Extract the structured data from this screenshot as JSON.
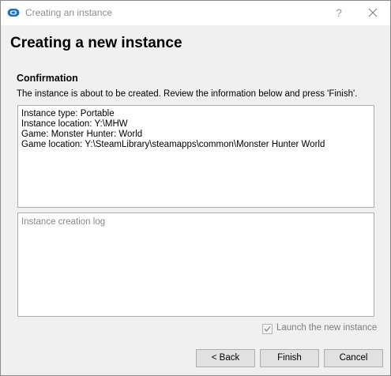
{
  "window": {
    "title": "Creating an instance",
    "help_glyph": "?",
    "app_icon": "mod-organizer-icon",
    "accent_color": "#1e73c8"
  },
  "page": {
    "heading": "Creating a new instance",
    "section_title": "Confirmation",
    "description": "The instance is about to be created. Review the information below and press 'Finish'."
  },
  "summary": {
    "lines": [
      "Instance type: Portable",
      "Instance location: Y:\\MHW",
      "Game: Monster Hunter: World",
      "Game location: Y:\\SteamLibrary\\steamapps\\common\\Monster Hunter World"
    ]
  },
  "log": {
    "placeholder": "Instance creation log"
  },
  "launch": {
    "label": "Launch the new instance",
    "checked": true,
    "enabled": false
  },
  "buttons": {
    "back": "< Back",
    "finish": "Finish",
    "cancel": "Cancel"
  }
}
